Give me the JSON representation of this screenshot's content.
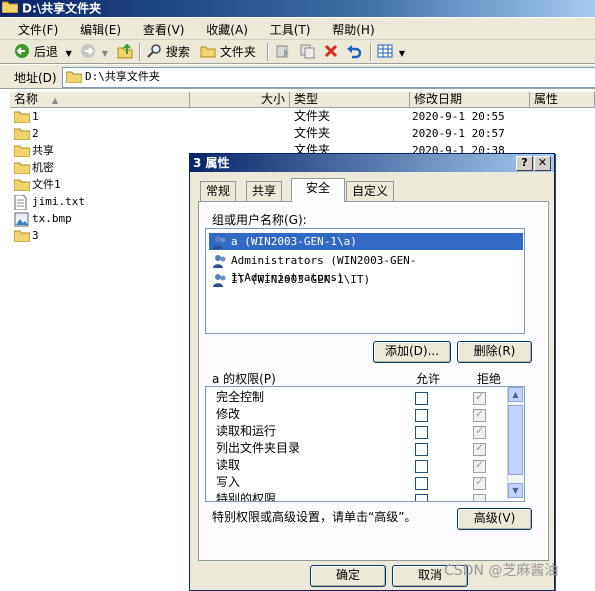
{
  "explorer": {
    "title": "D:\\共享文件夹",
    "menu": [
      "文件(F)",
      "编辑(E)",
      "查看(V)",
      "收藏(A)",
      "工具(T)",
      "帮助(H)"
    ],
    "toolbar": {
      "back_label": "后退",
      "search_label": "搜索",
      "folders_label": "文件夹"
    },
    "address": {
      "label": "地址(D)",
      "value": "D:\\共享文件夹"
    },
    "columns": {
      "name": "名称",
      "size": "大小",
      "type": "类型",
      "modified": "修改日期",
      "attributes": "属性"
    },
    "files": [
      {
        "name": "1",
        "icon": "folder-icon",
        "type": "文件夹",
        "modified": "2020-9-1 20:55"
      },
      {
        "name": "2",
        "icon": "folder-icon",
        "type": "文件夹",
        "modified": "2020-9-1 20:57"
      },
      {
        "name": "共享",
        "icon": "folder-icon",
        "type": "文件夹",
        "modified": "2020-9-1 20:38"
      },
      {
        "name": "机密",
        "icon": "folder-icon",
        "type": "",
        "modified": ""
      },
      {
        "name": "文件1",
        "icon": "folder-icon",
        "type": "",
        "modified": ""
      },
      {
        "name": "jimi.txt",
        "icon": "text-file-icon",
        "type": "",
        "modified": ""
      },
      {
        "name": "tx.bmp",
        "icon": "image-file-icon",
        "type": "",
        "modified": ""
      },
      {
        "name": "3",
        "icon": "folder-icon",
        "type": "",
        "modified": ""
      }
    ]
  },
  "dialog": {
    "title": "3 属性",
    "help_btn": "?",
    "close_btn": "✕",
    "tabs": [
      "常规",
      "共享",
      "安全",
      "自定义"
    ],
    "active_tab": "安全",
    "groups_label": "组或用户名称(G):",
    "users": [
      {
        "name": "a (WIN2003-GEN-1\\a)",
        "selected": true
      },
      {
        "name": "Administrators (WIN2003-GEN-1\\Administrators)",
        "selected": false
      },
      {
        "name": "IT (WIN2003-GEN-1\\IT)",
        "selected": false
      }
    ],
    "add_button": "添加(D)...",
    "remove_button": "删除(R)",
    "perm_label": "a 的权限(P)",
    "allow_header": "允许",
    "deny_header": "拒绝",
    "permissions": [
      {
        "name": "完全控制",
        "allow": false,
        "deny": true
      },
      {
        "name": "修改",
        "allow": false,
        "deny": true
      },
      {
        "name": "读取和运行",
        "allow": false,
        "deny": true
      },
      {
        "name": "列出文件夹目录",
        "allow": false,
        "deny": true
      },
      {
        "name": "读取",
        "allow": false,
        "deny": true
      },
      {
        "name": "写入",
        "allow": false,
        "deny": true
      },
      {
        "name": "特别的权限",
        "allow": false,
        "deny": false
      }
    ],
    "special_note": "特别权限或高级设置，请单击“高级”。",
    "advanced_button": "高级(V)",
    "ok_button": "确定",
    "cancel_button": "取消"
  },
  "watermark": "CSDN @芝麻酱油"
}
